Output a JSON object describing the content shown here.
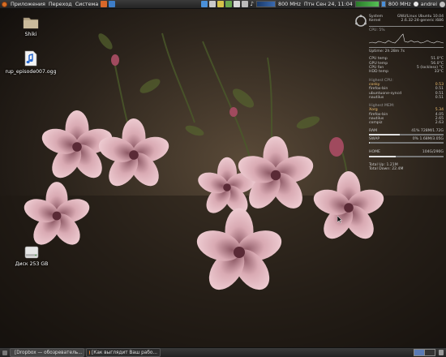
{
  "top_panel": {
    "menus": [
      "Приложения",
      "Переход",
      "Система"
    ],
    "cpu_freq_1": "800 MHz",
    "clock": "Птн Сен 24, 11:04",
    "cpu_freq_2": "800 MHz",
    "user": "andrei"
  },
  "desktop_icons": [
    {
      "label": "Shiki",
      "icon": "folder-icon"
    },
    {
      "label": "rup_episode007.ogg",
      "icon": "audio-file-icon"
    },
    {
      "label": "Диск 253 GB",
      "icon": "drive-icon"
    }
  ],
  "conky": {
    "system": {
      "label": "System",
      "value": "GNU/Linux Ubuntu 10.04"
    },
    "kernel": {
      "label": "Kernel",
      "value": "2.6.32-24-generic i686"
    },
    "cpu_label": "CPU: 5%",
    "uptime": "Uptime: 2h 28m 7s",
    "cpu_temp": {
      "label": "CPU temp",
      "value": "51.0°C"
    },
    "gpu_temp": {
      "label": "GPU temp",
      "value": "56.0°C"
    },
    "cpu_fan": {
      "label": "CPU fan",
      "value": "5 (lockless) °C"
    },
    "hdd_temp": {
      "label": "HDD temp",
      "value": "33°C"
    },
    "highest_cpu_title": "Highest CPU:",
    "top_cpu": [
      {
        "name": "conky",
        "value": "0.53"
      },
      {
        "name": "firefox-bin",
        "value": "0.51"
      },
      {
        "name": "ubuntuone-syncd",
        "value": "0.51"
      },
      {
        "name": "nautilus",
        "value": "0.51"
      }
    ],
    "highest_mem_title": "Highest MEM:",
    "top_mem": [
      {
        "name": "Xorg",
        "value": "5.34"
      },
      {
        "name": "firefox-bin",
        "value": "4.05"
      },
      {
        "name": "nautilus",
        "value": "2.65"
      },
      {
        "name": "compiz",
        "value": "2.63"
      }
    ],
    "ram": {
      "label": "RAM",
      "value": "41% 728M/1.72G",
      "percent": 41
    },
    "swap": {
      "label": "SWAP",
      "value": "0% 1.68M/3.05G",
      "percent": 1
    },
    "home": {
      "label": "HOME",
      "value": "104G/290G",
      "percent": 36
    },
    "upload": "Total Up:  1.21M",
    "download": "Total Down:  22.4M"
  },
  "taskbar": {
    "tasks": [
      {
        "label": "[Dropbox — обозреватель...",
        "active": true,
        "icon_color": "#3d7bc8"
      },
      {
        "label": "[Как выглядит Ваш рабо...",
        "active": false,
        "icon_color": "#e07a2a"
      }
    ]
  },
  "colors": {
    "accent": "#d86f25",
    "panel": "#2b2b2b"
  }
}
